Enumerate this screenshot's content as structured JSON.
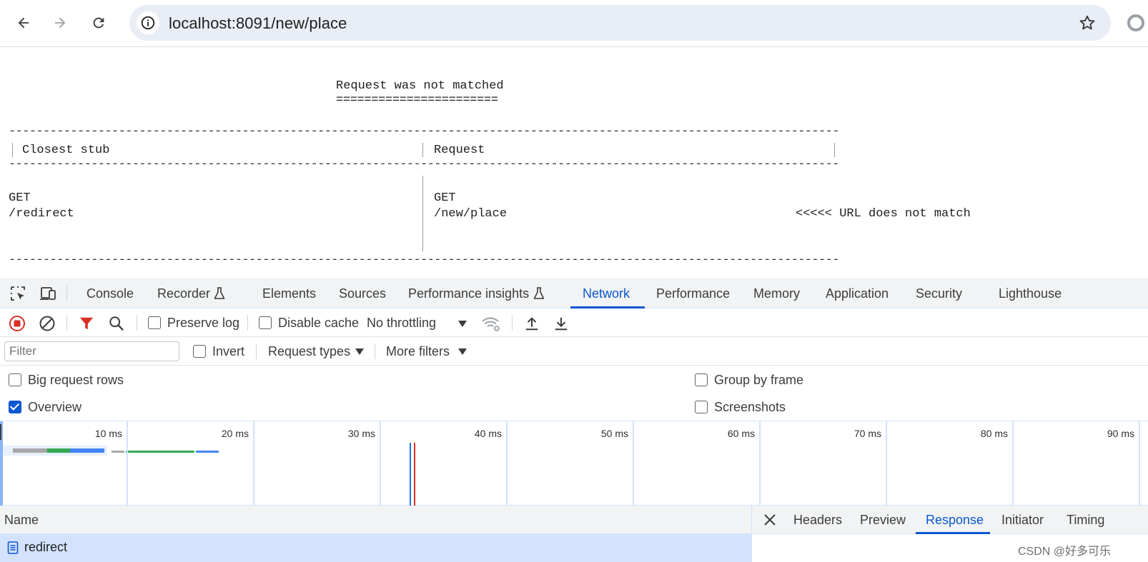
{
  "browser": {
    "url": "localhost:8091/new/place"
  },
  "page": {
    "heading": "Request was not matched",
    "heading_underline": "=======================",
    "col_closest_stub": "Closest stub",
    "col_request": "Request",
    "stub_method": "GET",
    "stub_url": "/redirect",
    "req_method": "GET",
    "req_url": "/new/place",
    "mismatch_note": "<<<<< URL does not match"
  },
  "devtools": {
    "tabs": [
      "Console",
      "Recorder",
      "Elements",
      "Sources",
      "Performance insights",
      "Network",
      "Performance",
      "Memory",
      "Application",
      "Security",
      "Lighthouse"
    ],
    "active_tab": "Network",
    "toolbar": {
      "preserve_log": "Preserve log",
      "preserve_log_checked": false,
      "disable_cache": "Disable cache",
      "disable_cache_checked": false,
      "throttling": "No throttling"
    },
    "filter_bar": {
      "filter_placeholder": "Filter",
      "invert": "Invert",
      "invert_checked": false,
      "request_types": "Request types",
      "more_filters": "More filters"
    },
    "settings": {
      "big_request_rows": "Big request rows",
      "big_request_rows_checked": false,
      "overview": "Overview",
      "overview_checked": true,
      "group_by_frame": "Group by frame",
      "group_by_frame_checked": false,
      "screenshots": "Screenshots",
      "screenshots_checked": false
    },
    "overview": {
      "ticks": [
        "10 ms",
        "20 ms",
        "30 ms",
        "40 ms",
        "50 ms",
        "60 ms",
        "70 ms",
        "80 ms",
        "90 ms"
      ]
    },
    "requests": {
      "name_header": "Name",
      "rows": [
        {
          "name": "redirect"
        }
      ]
    },
    "detail_tabs": [
      "Headers",
      "Preview",
      "Response",
      "Initiator",
      "Timing"
    ],
    "active_detail_tab": "Response",
    "colors": {
      "accent": "#0b57d0",
      "record": "#d93025",
      "selected_row": "#d3e3fd"
    }
  },
  "watermark": "CSDN @好多可乐"
}
